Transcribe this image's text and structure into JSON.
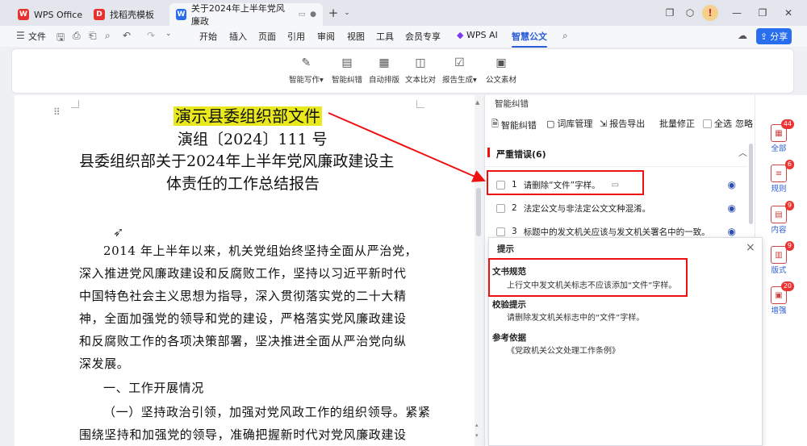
{
  "tabs": [
    {
      "label": "WPS Office"
    },
    {
      "label": "找稻壳模板"
    },
    {
      "label": "关于2024年上半年党风廉政"
    }
  ],
  "tab_plus": "+",
  "menu": {
    "file": "文件",
    "items": [
      "开始",
      "插入",
      "页面",
      "引用",
      "审阅",
      "视图",
      "工具",
      "会员专享"
    ],
    "wps_ai": "WPS AI",
    "active": "智慧公文",
    "share": "分享"
  },
  "ribbon": [
    {
      "label": "智能写作",
      "icon": "pen-icon",
      "dropdown": true
    },
    {
      "label": "智能纠错",
      "icon": "doc-check-icon"
    },
    {
      "label": "自动排版",
      "icon": "layout-icon"
    },
    {
      "label": "文本比对",
      "icon": "compare-icon"
    },
    {
      "label": "报告生成",
      "icon": "report-icon",
      "dropdown": true
    },
    {
      "label": "公文素材",
      "icon": "material-icon"
    }
  ],
  "document": {
    "header_org": "演示县委组织部文件",
    "doc_number": "演组〔2024〕111 号",
    "title_line1": "县委组织部关于2024年上半年党风廉政建设主",
    "title_line2": "体责任的工作总结报告",
    "body": [
      "2014 年上半年以来，机关党组始终坚持全面从严治党，",
      "深入推进党风廉政建设和反腐败工作，坚持以习近平新时代",
      "中国特色社会主义思想为指导，深入贯彻落实党的二十大精",
      "神，全面加强党的领导和党的建设，严格落实党风廉政建设",
      "和反腐败工作的各项决策部署，坚决推进全面从严治党向纵",
      "深发展。",
      "一、工作开展情况",
      "（一）坚持政治引领，加强对党风政工作的组织领导。紧紧",
      "围绕坚持和加强党的领导，准确把握新时代对党风廉政建设"
    ]
  },
  "panel": {
    "title": "智能纠错",
    "tools": [
      "智能纠错",
      "词库管理",
      "报告导出",
      "批量修正",
      "全选",
      "忽略"
    ],
    "section": "严重错误(6)",
    "errors": [
      {
        "num": "1",
        "text": "请删除“文件”字样。"
      },
      {
        "num": "2",
        "text": "法定公文与非法定公文文种混淆。"
      },
      {
        "num": "3",
        "text": "标题中的发文机关应该与发文机关署名中的一致。"
      }
    ]
  },
  "tip": {
    "title": "提示",
    "close": "×",
    "h1": "文书规范",
    "t1": "上行文中发文机关标志不应该添加“文件”字样。",
    "h2": "校验提示",
    "t2": "请删除发文机关标志中的“文件”字样。",
    "h3": "参考依据",
    "t3": "《党政机关公文处理工作条例》"
  },
  "sidebar": [
    {
      "label": "全部",
      "count": "44"
    },
    {
      "label": "规则",
      "count": "6"
    },
    {
      "label": "内容",
      "count": "9"
    },
    {
      "label": "版式",
      "count": "9"
    },
    {
      "label": "增强",
      "count": "20"
    }
  ],
  "colors": {
    "accent": "#2a5bd7",
    "highlight": "#e9e81d",
    "annotation": "#ee1111"
  }
}
